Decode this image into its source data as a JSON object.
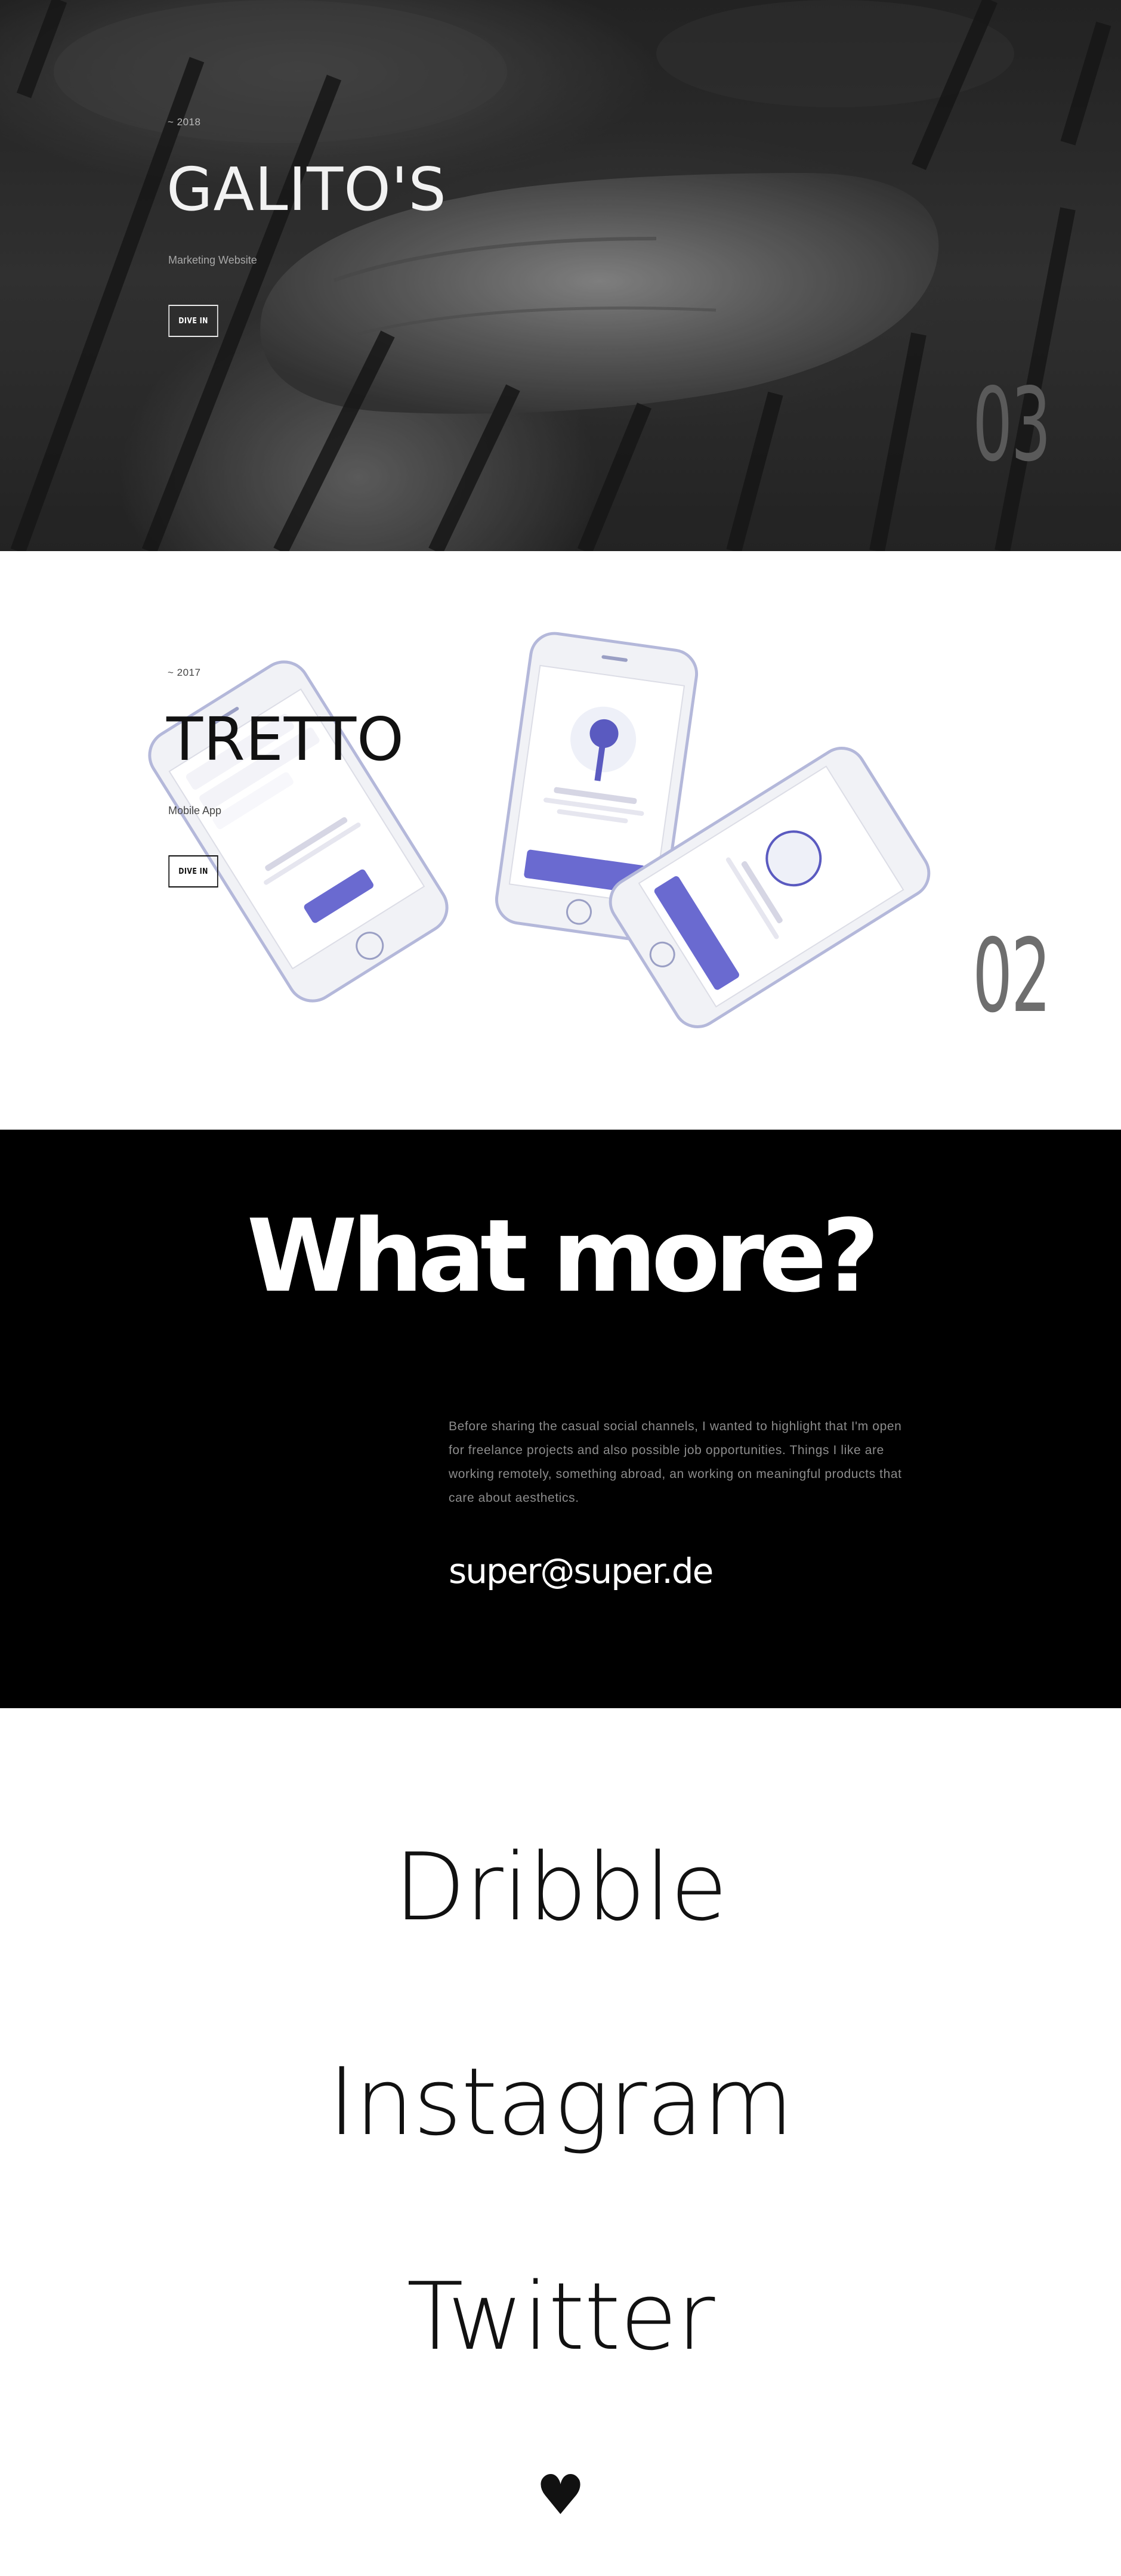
{
  "projects": [
    {
      "number": "03",
      "year": "~ 2018",
      "title": "GALITO'S",
      "subtitle": "Marketing Website",
      "cta": "DIVE IN"
    },
    {
      "number": "02",
      "year": "~ 2017",
      "title": "TRETTO",
      "subtitle": "Mobile App",
      "cta": "DIVE IN"
    }
  ],
  "contact": {
    "title": "What more?",
    "body": "Before sharing the casual social channels, I wanted to highlight that I'm open for freelance projects and also possible job opportunities. Things I like are working remotely, something abroad, an working on meaningful products that care about aesthetics.",
    "email": "super@super.de"
  },
  "social": {
    "links": [
      "Dribble",
      "Instagram",
      "Twitter"
    ],
    "footer_icon": "heart-icon"
  },
  "colors": {
    "accent": "#6a6ad0",
    "dark_bg": "#000000",
    "light_bg": "#ffffff"
  }
}
